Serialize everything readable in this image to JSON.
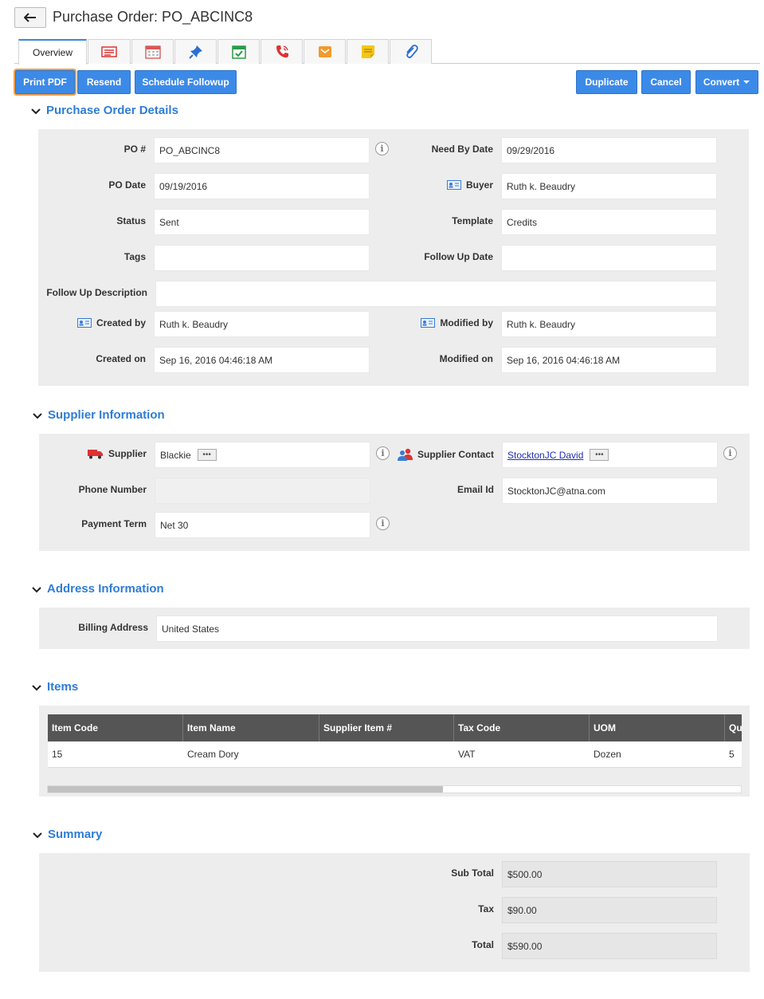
{
  "header": {
    "title": "Purchase Order: PO_ABCINC8"
  },
  "tabs": [
    {
      "label": "Overview"
    },
    {
      "icon": "details-list-icon"
    },
    {
      "icon": "calendar-icon"
    },
    {
      "icon": "pin-icon"
    },
    {
      "icon": "task-icon"
    },
    {
      "icon": "phone-icon"
    },
    {
      "icon": "email-icon"
    },
    {
      "icon": "note-icon"
    },
    {
      "icon": "attachment-icon"
    }
  ],
  "toolbar": {
    "print_pdf": "Print PDF",
    "resend": "Resend",
    "schedule_followup": "Schedule Followup",
    "duplicate": "Duplicate",
    "cancel": "Cancel",
    "convert": "Convert"
  },
  "po_details": {
    "title": "Purchase Order Details",
    "po_no_label": "PO #",
    "po_no": "PO_ABCINC8",
    "need_by_label": "Need By Date",
    "need_by": "09/29/2016",
    "po_date_label": "PO Date",
    "po_date": "09/19/2016",
    "buyer_label": "Buyer",
    "buyer": "Ruth k. Beaudry",
    "status_label": "Status",
    "status": "Sent",
    "template_label": "Template",
    "template": "Credits",
    "tags_label": "Tags",
    "tags": "",
    "followup_date_label": "Follow Up Date",
    "followup_date": "",
    "followup_desc_label": "Follow Up Description",
    "followup_desc": "",
    "created_by_label": "Created by",
    "created_by": "Ruth k. Beaudry",
    "modified_by_label": "Modified by",
    "modified_by": "Ruth k. Beaudry",
    "created_on_label": "Created on",
    "created_on": "Sep 16, 2016 04:46:18 AM",
    "modified_on_label": "Modified on",
    "modified_on": "Sep 16, 2016 04:46:18 AM"
  },
  "supplier": {
    "title": "Supplier Information",
    "supplier_label": "Supplier",
    "supplier": "Blackie",
    "contact_label": "Supplier Contact",
    "contact": "StocktonJC David",
    "phone_label": "Phone Number",
    "phone": "",
    "email_label": "Email Id",
    "email": "StocktonJC@atna.com",
    "payment_label": "Payment Term",
    "payment": "Net 30"
  },
  "address": {
    "title": "Address Information",
    "billing_label": "Billing Address",
    "billing": "United States"
  },
  "items": {
    "title": "Items",
    "columns": [
      "Item Code",
      "Item Name",
      "Supplier Item #",
      "Tax Code",
      "UOM",
      "Qu"
    ],
    "rows": [
      [
        "15",
        "Cream Dory",
        "",
        "VAT",
        "Dozen",
        "5"
      ]
    ]
  },
  "summary": {
    "title": "Summary",
    "subtotal_label": "Sub Total",
    "subtotal": "$500.00",
    "tax_label": "Tax",
    "tax": "$90.00",
    "total_label": "Total",
    "total": "$590.00"
  }
}
